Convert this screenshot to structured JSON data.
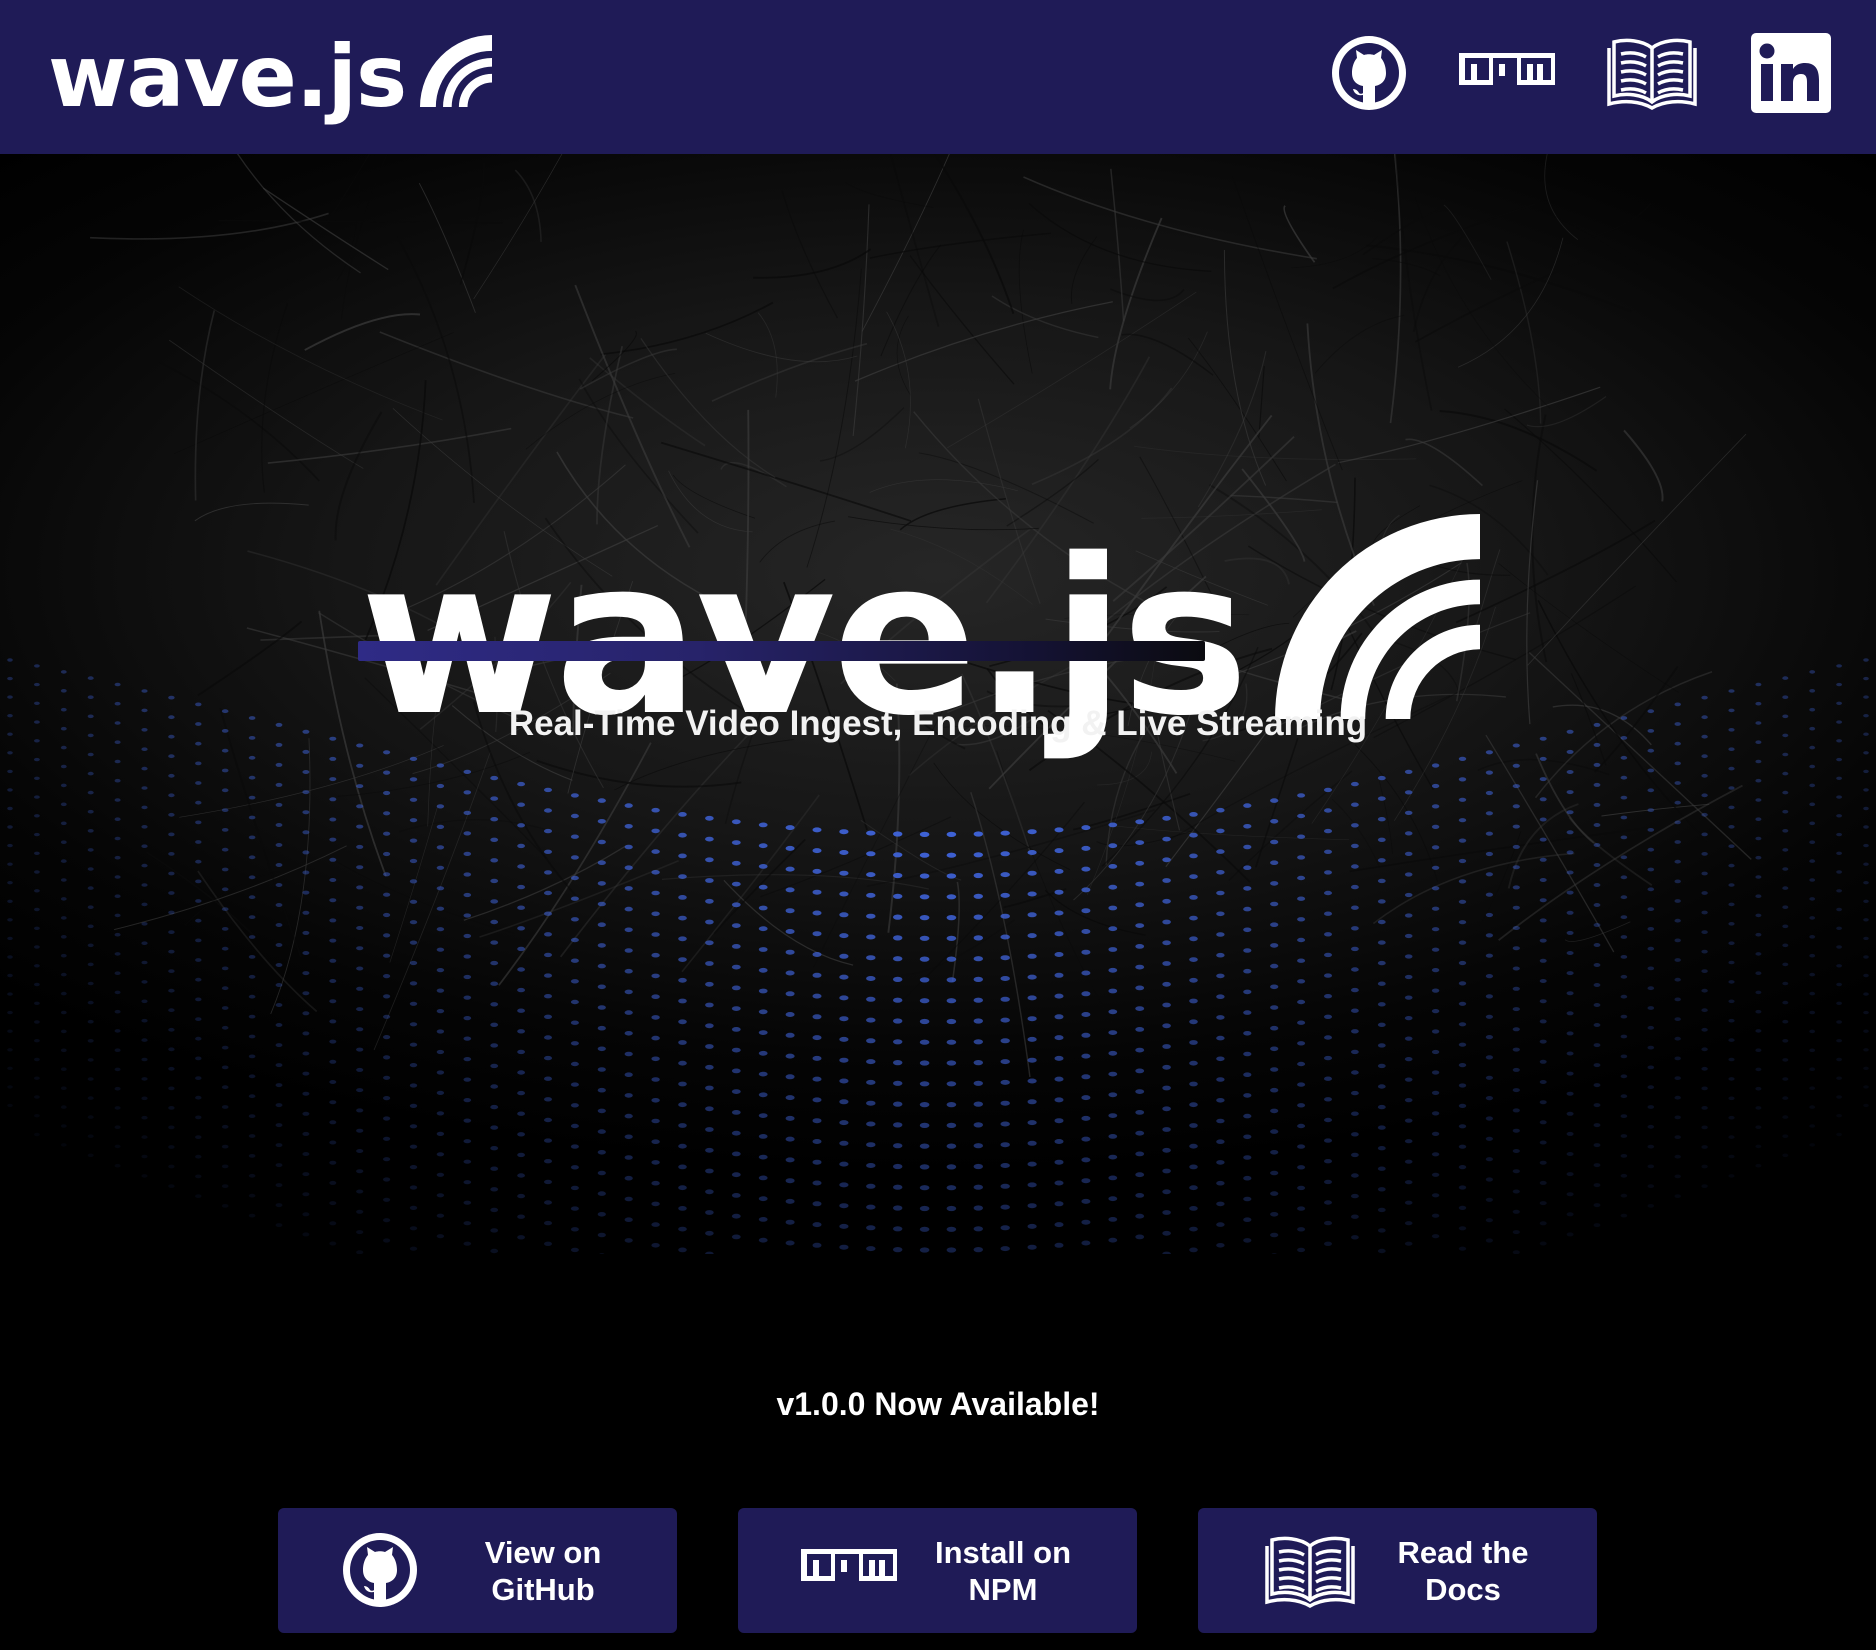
{
  "colors": {
    "brand_navy": "#1f1b57",
    "background": "#000000",
    "dot_blue": "#3f63d8",
    "text": "#ffffff"
  },
  "nav": {
    "logo_text": "wave.js",
    "links": [
      {
        "name": "github",
        "icon": "github-icon"
      },
      {
        "name": "npm",
        "icon": "npm-icon",
        "text": "npm"
      },
      {
        "name": "docs",
        "icon": "book-icon"
      },
      {
        "name": "linkedin",
        "icon": "linkedin-icon",
        "text": "in"
      }
    ]
  },
  "hero": {
    "logo_text": "wave.js",
    "tagline": "Real-Time Video Ingest, Encoding & Live Streaming"
  },
  "announcement": "v1.0.0 Now Available!",
  "cta": [
    {
      "label_line1": "View on",
      "label_line2": "GitHub",
      "icon": "github-icon"
    },
    {
      "label_line1": "Install on",
      "label_line2": "NPM",
      "icon": "npm-icon",
      "icon_text": "npm"
    },
    {
      "label_line1": "Read the",
      "label_line2": "Docs",
      "icon": "book-icon"
    }
  ]
}
